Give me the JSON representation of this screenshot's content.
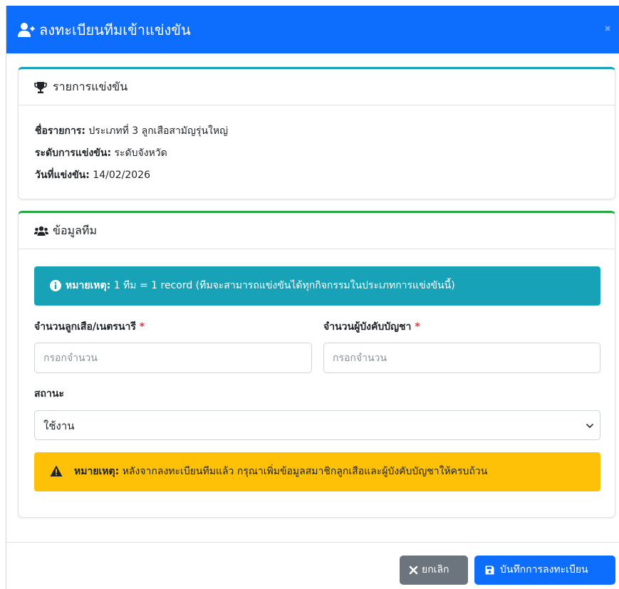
{
  "modal": {
    "title": "ลงทะเบียนทีมเข้าแข่งขัน",
    "header_icon": "user-plus-icon",
    "close_icon": "close-icon",
    "accent_color": "#0d6efd"
  },
  "competition_card": {
    "title": "รายการแข่งขัน",
    "icon": "trophy-icon",
    "border_color": "#17a2b8",
    "fields": [
      {
        "label": "ชื่อรายการ:",
        "value": "ประเภทที่ 3 ลูกเสือสามัญรุ่นใหญ่"
      },
      {
        "label": "ระดับการแข่งขัน:",
        "value": "ระดับจังหวัด"
      },
      {
        "label": "วันที่แข่งขัน:",
        "value": "14/02/2026"
      }
    ]
  },
  "team_card": {
    "title": "ข้อมูลทีม",
    "icon": "users-icon",
    "border_color": "#28a745",
    "info_alert": {
      "icon": "info-circle-icon",
      "label": "หมายเหตุ:",
      "text": "1 ทีม = 1 record (ทีมจะสามารถแข่งขันได้ทุกกิจกรรมในประเภทการแข่งขันนี้)",
      "color": "#17a2b8"
    },
    "scouts_field": {
      "label": "จำนวนลูกเสือ/เนตรนารี",
      "required": "*",
      "placeholder": "กรอกจำนวน",
      "value": ""
    },
    "leaders_field": {
      "label": "จำนวนผู้บังคับบัญชา",
      "required": "*",
      "placeholder": "กรอกจำนวน",
      "value": ""
    },
    "status_field": {
      "label": "สถานะ",
      "selected": "ใช้งาน",
      "icon": "chevron-down-icon"
    },
    "warning_alert": {
      "icon": "warning-triangle-icon",
      "label": "หมายเหตุ:",
      "text": "หลังจากลงทะเบียนทีมแล้ว กรุณาเพิ่มข้อมูลสมาชิกลูกเสือและผู้บังคับบัญชาให้ครบถ้วน",
      "color": "#ffc107"
    }
  },
  "footer": {
    "cancel_label": "ยกเลิก",
    "cancel_icon": "times-icon",
    "cancel_color": "#6c757d",
    "save_label": "บันทึกการลงทะเบียน",
    "save_icon": "save-icon",
    "save_color": "#0d6efd"
  }
}
